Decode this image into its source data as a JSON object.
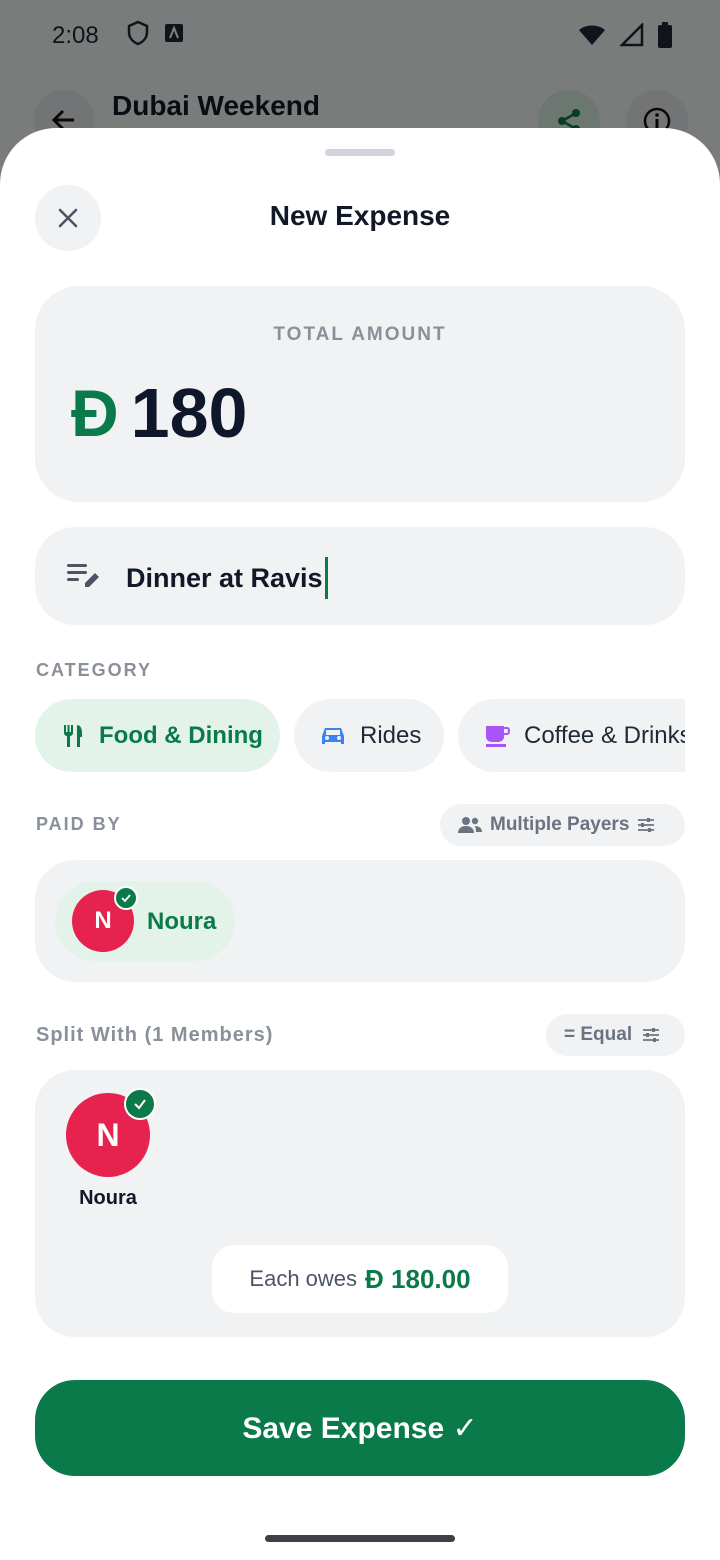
{
  "status_bar": {
    "time": "2:08"
  },
  "background_screen": {
    "title": "Dubai Weekend"
  },
  "sheet": {
    "title": "New Expense",
    "amount": {
      "label": "TOTAL AMOUNT",
      "currency_symbol": "Đ",
      "value": "180"
    },
    "description": {
      "value": "Dinner at Ravis"
    },
    "category": {
      "label": "CATEGORY",
      "chips": [
        {
          "label": "Food & Dining",
          "icon": "fork-knife-icon",
          "selected": true
        },
        {
          "label": "Rides",
          "icon": "car-icon",
          "selected": false
        },
        {
          "label": "Coffee & Drinks",
          "icon": "coffee-icon",
          "selected": false
        }
      ]
    },
    "paid_by": {
      "label": "PAID BY",
      "multiple_payers_label": "Multiple Payers",
      "payer": {
        "initial": "N",
        "name": "Noura"
      }
    },
    "split": {
      "label": "Split With (1 Members)",
      "mode_label": "= Equal",
      "members": [
        {
          "initial": "N",
          "name": "Noura"
        }
      ],
      "each_owes_label": "Each owes",
      "each_owes_currency": "Đ",
      "each_owes_value": "180.00"
    },
    "save_label": "Save Expense ✓"
  },
  "colors": {
    "accent": "#0a7a4a",
    "avatar": "#e5234e",
    "card_bg": "#f1f2f4",
    "chip_selected_bg": "#e3f3ea"
  }
}
